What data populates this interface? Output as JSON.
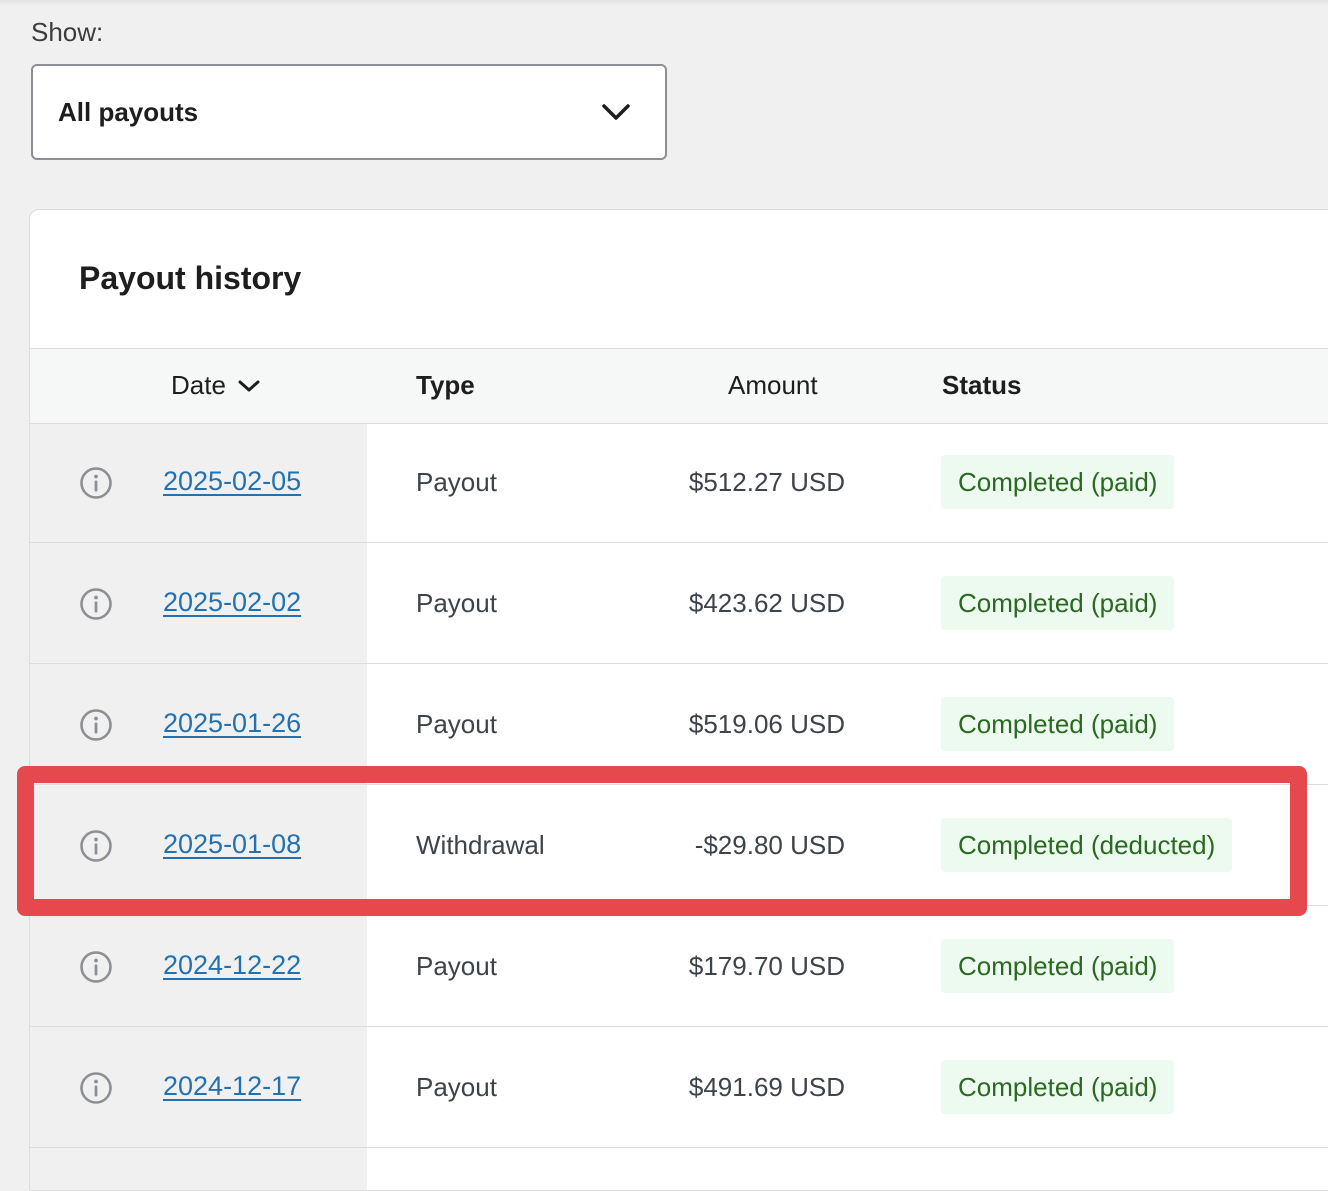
{
  "filter": {
    "label": "Show:",
    "selected": "All payouts"
  },
  "card": {
    "title": "Payout history"
  },
  "table": {
    "columns": {
      "date": "Date",
      "type": "Type",
      "amount": "Amount",
      "status": "Status"
    },
    "rows": [
      {
        "date": "2025-02-05",
        "type": "Payout",
        "amount": "$512.27 USD",
        "status": "Completed (paid)"
      },
      {
        "date": "2025-02-02",
        "type": "Payout",
        "amount": "$423.62 USD",
        "status": "Completed (paid)"
      },
      {
        "date": "2025-01-26",
        "type": "Payout",
        "amount": "$519.06 USD",
        "status": "Completed (paid)"
      },
      {
        "date": "2025-01-08",
        "type": "Withdrawal",
        "amount": "-$29.80 USD",
        "status": "Completed (deducted)"
      },
      {
        "date": "2024-12-22",
        "type": "Payout",
        "amount": "$179.70 USD",
        "status": "Completed (paid)"
      },
      {
        "date": "2024-12-17",
        "type": "Payout",
        "amount": "$491.69 USD",
        "status": "Completed (paid)"
      }
    ]
  },
  "icons": {
    "info": "info-circle-icon",
    "dropdown": "chevron-down-icon",
    "sort": "chevron-down-icon"
  },
  "colors": {
    "link": "#2271b1",
    "badge_bg": "#edfaef",
    "badge_text": "#2a6a20",
    "highlight": "#e5484d"
  }
}
